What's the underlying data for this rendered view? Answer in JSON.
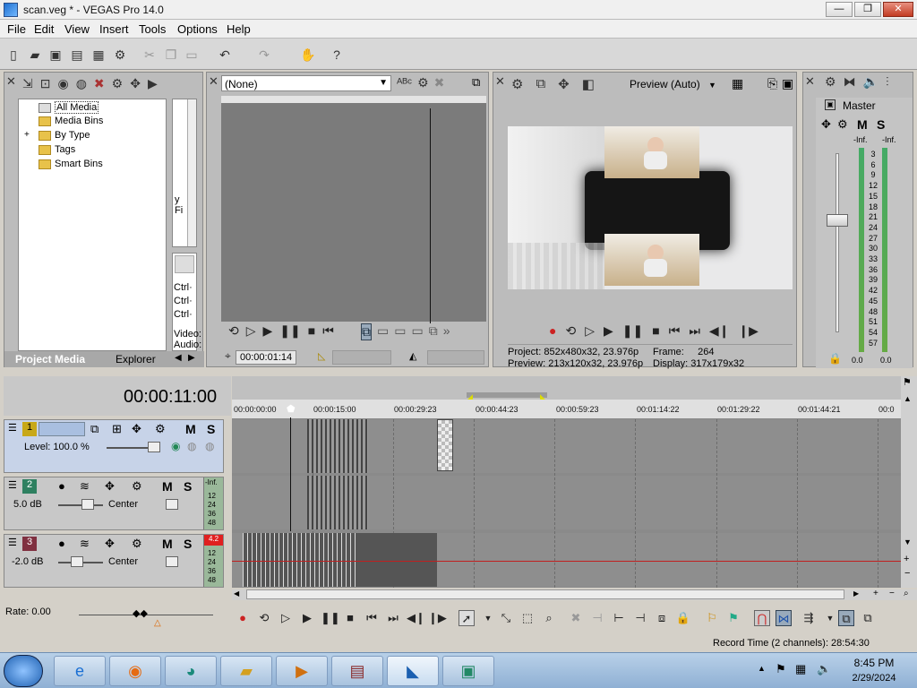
{
  "window": {
    "title": "scan.veg * - VEGAS Pro 14.0",
    "minimize": "—",
    "maximize": "❐",
    "close": "✕"
  },
  "menu": [
    "File",
    "Edit",
    "View",
    "Insert",
    "Tools",
    "Options",
    "Help"
  ],
  "media": {
    "tree": [
      "All Media",
      "Media Bins",
      "By Type",
      "Tags",
      "Smart Bins"
    ],
    "expander": "+",
    "tabs": [
      "Project Media",
      "Explorer"
    ],
    "side_text": [
      "y",
      "Fi",
      "Ctrl·",
      "Ctrl·",
      "Ctrl·",
      "Video:",
      "Audio:"
    ]
  },
  "trimmer": {
    "preset": "(None)",
    "timecode": "00:00:01:14"
  },
  "preview": {
    "quality": "Preview (Auto)",
    "project_label": "Project:",
    "project_value": "852x480x32, 23.976p",
    "preview_label": "Preview:",
    "preview_value": "213x120x32, 23.976p",
    "frame_label": "Frame:",
    "frame_value": "264",
    "display_label": "Display:",
    "display_value": "317x179x32"
  },
  "master": {
    "label": "Master",
    "m": "M",
    "s": "S",
    "peak_left": "-Inf.",
    "peak_right": "-Inf.",
    "scale": [
      "3",
      "6",
      "9",
      "12",
      "15",
      "18",
      "21",
      "24",
      "27",
      "30",
      "33",
      "36",
      "39",
      "42",
      "45",
      "48",
      "51",
      "54",
      "57"
    ],
    "level_left": "0.0",
    "level_right": "0.0"
  },
  "timeline": {
    "cursor_time": "00:00:11:00",
    "ruler": [
      "00:00:00:00",
      "00:00:15:00",
      "00:00:29:23",
      "00:00:44:23",
      "00:00:59:23",
      "00:01:14:22",
      "00:01:29:22",
      "00:01:44:21",
      "00:0"
    ],
    "tracks": [
      {
        "number": "1",
        "kind": "video",
        "m": "M",
        "s": "S",
        "level": "Level: 100.0 %"
      },
      {
        "number": "2",
        "kind": "audio",
        "m": "M",
        "s": "S",
        "volume": "5.0 dB",
        "pan": "Center",
        "peak": "-Inf.",
        "meter": [
          "12",
          "24",
          "36",
          "48"
        ]
      },
      {
        "number": "3",
        "kind": "audio",
        "m": "M",
        "s": "S",
        "volume": "-2.0 dB",
        "pan": "Center",
        "peak": "4.2",
        "meter": [
          "12",
          "24",
          "36",
          "48"
        ]
      }
    ]
  },
  "bottom": {
    "rate": "Rate: 0.00",
    "record_time": "Record Time (2 channels): 28:54:30"
  },
  "taskbar": {
    "time": "8:45 PM",
    "date": "2/29/2024"
  },
  "colors": {
    "track1_badge": "#c8a818",
    "track2_badge": "#2e8060",
    "track3_badge": "#803040",
    "peak_red": "#e02020"
  }
}
